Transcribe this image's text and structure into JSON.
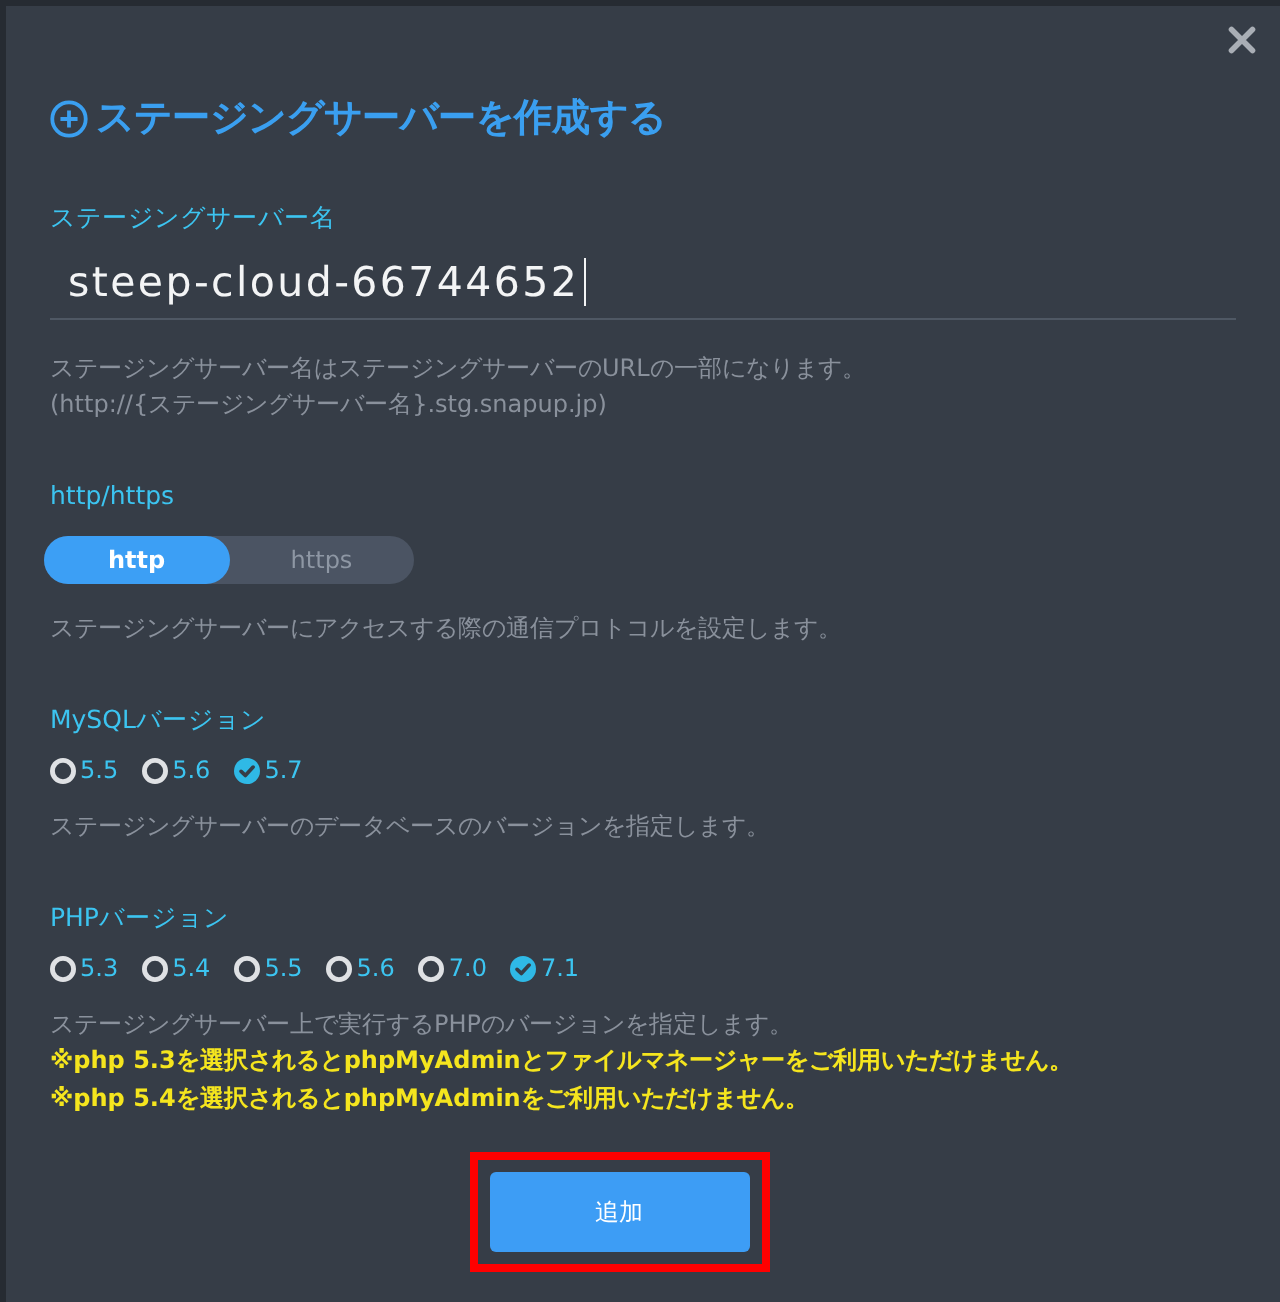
{
  "dialog": {
    "title": "ステージングサーバーを作成する"
  },
  "sections": [
    {
      "kind": "text",
      "label": "ステージングサーバー名",
      "value": "steep-cloud-66744652",
      "focused": true,
      "help": [
        "ステージングサーバー名はステージングサーバーのURLの一部になります。",
        "(http://{ステージングサーバー名}.stg.snapup.jp)"
      ]
    },
    {
      "kind": "segmented",
      "label": "http/https",
      "options": [
        {
          "label": "http",
          "selected": true
        },
        {
          "label": "https",
          "selected": false
        }
      ],
      "help": [
        "ステージングサーバーにアクセスする際の通信プロトコルを設定します。"
      ]
    },
    {
      "kind": "radio",
      "label": "MySQLバージョン",
      "options": [
        {
          "label": "5.5",
          "selected": false
        },
        {
          "label": "5.6",
          "selected": false
        },
        {
          "label": "5.7",
          "selected": true
        }
      ],
      "help": [
        "ステージングサーバーのデータベースのバージョンを指定します。"
      ]
    },
    {
      "kind": "radio",
      "label": "PHPバージョン",
      "options": [
        {
          "label": "5.3",
          "selected": false
        },
        {
          "label": "5.4",
          "selected": false
        },
        {
          "label": "5.5",
          "selected": false
        },
        {
          "label": "5.6",
          "selected": false
        },
        {
          "label": "7.0",
          "selected": false
        },
        {
          "label": "7.1",
          "selected": true
        }
      ],
      "help": [
        "ステージングサーバー上で実行するPHPのバージョンを指定します。"
      ],
      "warnings": [
        "※php 5.3を選択されるとphpMyAdminとファイルマネージャーをご利用いただけません。",
        "※php 5.4を選択されるとphpMyAdminをご利用いただけません。"
      ]
    }
  ],
  "submit": {
    "label": "追加",
    "highlighted": true
  }
}
